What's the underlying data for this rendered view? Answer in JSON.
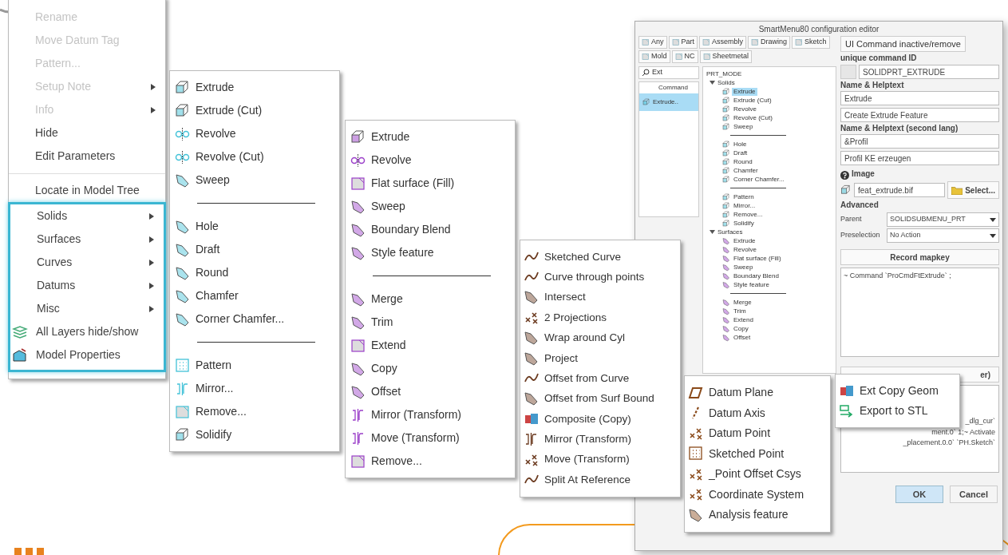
{
  "context_menu": {
    "items": [
      {
        "label": "Rename",
        "kind": "command",
        "disabled": true
      },
      {
        "label": "Move Datum Tag",
        "kind": "command",
        "disabled": true
      },
      {
        "label": "Pattern...",
        "kind": "command",
        "disabled": true
      },
      {
        "label": "Setup Note",
        "kind": "submenu",
        "disabled": true
      },
      {
        "label": "Info",
        "kind": "submenu",
        "disabled": true
      },
      {
        "label": "Hide",
        "kind": "command",
        "disabled": false
      },
      {
        "label": "Edit Parameters",
        "kind": "command",
        "disabled": false
      },
      {
        "kind": "separator"
      },
      {
        "label": "Locate in Model Tree",
        "kind": "command",
        "disabled": false
      }
    ],
    "highlighted_items": [
      {
        "label": "Solids",
        "kind": "submenu",
        "disabled": false
      },
      {
        "label": "Surfaces",
        "kind": "submenu",
        "disabled": false
      },
      {
        "label": "Curves",
        "kind": "submenu",
        "disabled": false
      },
      {
        "label": "Datums",
        "kind": "submenu",
        "disabled": false
      },
      {
        "label": "Misc",
        "kind": "submenu",
        "disabled": false
      },
      {
        "label": "All Layers hide/show",
        "kind": "command",
        "disabled": false
      },
      {
        "label": "Model Properties",
        "kind": "command",
        "disabled": false
      }
    ]
  },
  "solids_menu": {
    "items": [
      {
        "kind": "command",
        "label": "Extrude"
      },
      {
        "kind": "command",
        "label": "Extrude (Cut)"
      },
      {
        "kind": "command",
        "label": "Revolve"
      },
      {
        "kind": "command",
        "label": "Revolve (Cut)"
      },
      {
        "kind": "command",
        "label": "Sweep"
      },
      {
        "kind": "separator"
      },
      {
        "kind": "command",
        "label": "Hole"
      },
      {
        "kind": "command",
        "label": "Draft"
      },
      {
        "kind": "command",
        "label": "Round"
      },
      {
        "kind": "command",
        "label": "Chamfer"
      },
      {
        "kind": "command",
        "label": "Corner Chamfer..."
      },
      {
        "kind": "separator"
      },
      {
        "kind": "command",
        "label": "Pattern"
      },
      {
        "kind": "command",
        "label": "Mirror..."
      },
      {
        "kind": "command",
        "label": "Remove..."
      },
      {
        "kind": "command",
        "label": "Solidify"
      }
    ]
  },
  "surfaces_menu": {
    "items": [
      {
        "kind": "command",
        "label": "Extrude"
      },
      {
        "kind": "command",
        "label": "Revolve"
      },
      {
        "kind": "command",
        "label": "Flat surface (Fill)"
      },
      {
        "kind": "command",
        "label": "Sweep"
      },
      {
        "kind": "command",
        "label": "Boundary Blend"
      },
      {
        "kind": "command",
        "label": "Style feature"
      },
      {
        "kind": "separator"
      },
      {
        "kind": "command",
        "label": "Merge"
      },
      {
        "kind": "command",
        "label": "Trim"
      },
      {
        "kind": "command",
        "label": "Extend"
      },
      {
        "kind": "command",
        "label": "Copy"
      },
      {
        "kind": "command",
        "label": "Offset"
      },
      {
        "kind": "command",
        "label": "Mirror (Transform)"
      },
      {
        "kind": "command",
        "label": "Move (Transform)"
      },
      {
        "kind": "command",
        "label": "Remove..."
      }
    ]
  },
  "curves_menu": {
    "items": [
      {
        "kind": "command",
        "label": "Sketched Curve"
      },
      {
        "kind": "command",
        "label": "Curve through points"
      },
      {
        "kind": "command",
        "label": "Intersect"
      },
      {
        "kind": "command",
        "label": "2 Projections"
      },
      {
        "kind": "command",
        "label": "Wrap around Cyl"
      },
      {
        "kind": "command",
        "label": "Project"
      },
      {
        "kind": "command",
        "label": "Offset from Curve"
      },
      {
        "kind": "command",
        "label": "Offset from Surf Bound"
      },
      {
        "kind": "command",
        "label": "Composite (Copy)"
      },
      {
        "kind": "command",
        "label": "Mirror (Transform)"
      },
      {
        "kind": "command",
        "label": "Move (Transform)"
      },
      {
        "kind": "command",
        "label": "Split At Reference"
      }
    ]
  },
  "datums_menu": {
    "items": [
      {
        "kind": "command",
        "label": "Datum Plane"
      },
      {
        "kind": "command",
        "label": "Datum Axis"
      },
      {
        "kind": "command",
        "label": "Datum Point"
      },
      {
        "kind": "command",
        "label": "Sketched Point"
      },
      {
        "kind": "command",
        "label": "_Point Offset Csys"
      },
      {
        "kind": "command",
        "label": "Coordinate System"
      },
      {
        "kind": "command",
        "label": "Analysis feature"
      }
    ]
  },
  "misc_menu": {
    "items": [
      {
        "kind": "command",
        "label": "Ext Copy Geom"
      },
      {
        "kind": "command",
        "label": "Export to STL"
      }
    ]
  },
  "editor_window": {
    "title": "SmartMenu80 configuration editor",
    "tabs": [
      "Any",
      "Part",
      "Assembly",
      "Drawing",
      "Sketch",
      "Mold",
      "NC",
      "Sheetmetal"
    ],
    "inactive_button": "UI Command inactive/remove",
    "search": {
      "value": "Ext"
    },
    "command_list": {
      "header": "Command",
      "rows": [
        {
          "label": "Extrude..",
          "selected": true
        }
      ]
    },
    "tree": {
      "label": "PRT_MODE",
      "children": [
        {
          "label": "Solids",
          "expanded": true,
          "children": [
            {
              "kind": "item",
              "label": "Extrude",
              "selected": true
            },
            {
              "kind": "item",
              "label": "Extrude (Cut)",
              "selected": false
            },
            {
              "kind": "item",
              "label": "Revolve",
              "selected": false
            },
            {
              "kind": "item",
              "label": "Revolve (Cut)",
              "selected": false
            },
            {
              "kind": "item",
              "label": "Sweep",
              "selected": false
            },
            {
              "kind": "separator"
            },
            {
              "kind": "item",
              "label": "Hole",
              "selected": false
            },
            {
              "kind": "item",
              "label": "Draft",
              "selected": false
            },
            {
              "kind": "item",
              "label": "Round",
              "selected": false
            },
            {
              "kind": "item",
              "label": "Chamfer",
              "selected": false
            },
            {
              "kind": "item",
              "label": "Corner Chamfer...",
              "selected": false
            },
            {
              "kind": "separator"
            },
            {
              "kind": "item",
              "label": "Pattern",
              "selected": false
            },
            {
              "kind": "item",
              "label": "Mirror...",
              "selected": false
            },
            {
              "kind": "item",
              "label": "Remove...",
              "selected": false
            },
            {
              "kind": "item",
              "label": "Solidify",
              "selected": false
            }
          ]
        },
        {
          "label": "Surfaces",
          "expanded": true,
          "children": [
            {
              "kind": "item",
              "label": "Extrude",
              "selected": false
            },
            {
              "kind": "item",
              "label": "Revolve",
              "selected": false
            },
            {
              "kind": "item",
              "label": "Flat surface (Fill)",
              "selected": false
            },
            {
              "kind": "item",
              "label": "Sweep",
              "selected": false
            },
            {
              "kind": "item",
              "label": "Boundary Blend",
              "selected": false
            },
            {
              "kind": "item",
              "label": "Style feature",
              "selected": false
            },
            {
              "kind": "separator"
            },
            {
              "kind": "item",
              "label": "Merge",
              "selected": false
            },
            {
              "kind": "item",
              "label": "Trim",
              "selected": false
            },
            {
              "kind": "item",
              "label": "Extend",
              "selected": false
            },
            {
              "kind": "item",
              "label": "Copy",
              "selected": false
            },
            {
              "kind": "item",
              "label": "Offset",
              "selected": false
            }
          ]
        }
      ]
    },
    "command_id": {
      "label": "unique command ID",
      "value": "SOLIDPRT_EXTRUDE"
    },
    "name_helptext": {
      "label": "Name & Helptext",
      "name": "Extrude",
      "helptext": "Create Extrude Feature"
    },
    "name_helptext_second": {
      "label": "Name & Helptext (second lang)",
      "name": "&Profil",
      "helptext": "Profil KE erzeugen"
    },
    "image": {
      "label": "Image",
      "value": "feat_extrude.bif",
      "button": "Select..."
    },
    "advanced": {
      "label": "Advanced",
      "parent_label": "Parent",
      "parent_value": "SOLIDSUBMENU_PRT",
      "preselection_label": "Preselection",
      "preselection_value": "No Action"
    },
    "record_button": "Record mapkey",
    "mapkey_text": "~ Command `ProCmdFtExtrude` ;",
    "second_button_tail": "er)",
    "second_text_lines": [
      "_dlg_cur`",
      "ment.0` 1;~ Activate",
      "_placement.0.0` `PH.Sketch`"
    ],
    "ok_button": "OK",
    "cancel_button": "Cancel"
  }
}
